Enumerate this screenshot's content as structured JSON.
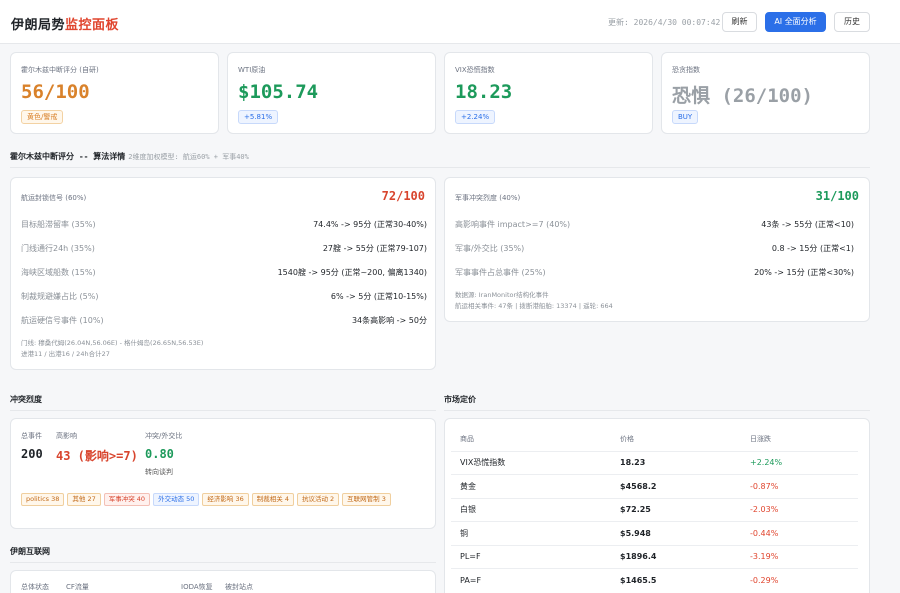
{
  "header": {
    "title_main": "伊朗局势",
    "title_accent": "监控面板",
    "updated": "更新: 2026/4/30 00:07:42",
    "btn_refresh": "刷新",
    "btn_ai": "AI 全面分析",
    "btn_history": "历史"
  },
  "kpis": [
    {
      "label": "霍尔木兹中断评分 (自研)",
      "value": "56/100",
      "badge": "黄色/警戒",
      "color": "#d9822b"
    },
    {
      "label": "WTI原油",
      "value": "$105.74",
      "badge": "+5.81%",
      "color": "#1d9a5b"
    },
    {
      "label": "VIX恐慌指数",
      "value": "18.23",
      "badge": "+2.24%",
      "color": "#1d9a5b"
    },
    {
      "label": "恐贪指数",
      "value": "恐惧 (26/100)",
      "badge": "BUY",
      "color": "#9aa0a6"
    }
  ],
  "algo": {
    "title": "霍尔木兹中断评分 -- 算法详情",
    "subtitle": "2维度加权模型: 航运60% + 军事40%"
  },
  "shipping": {
    "head": "航运封锁信号 (60%)",
    "score": "72/100",
    "rows": [
      {
        "k": "目标船滞留率 (35%)",
        "v": "74.4% -> 95分 (正常30-40%)"
      },
      {
        "k": "门线通行24h (35%)",
        "v": "27艘 -> 55分 (正常79-107)"
      },
      {
        "k": "海峡区域船数 (15%)",
        "v": "1540艘 -> 95分 (正常~200, 偏离1340)"
      },
      {
        "k": "制裁规避嫌占比 (5%)",
        "v": "6% -> 5分 (正常10-15%)"
      },
      {
        "k": "航运硬信号事件 (10%)",
        "v": "34条高影响 -> 50分"
      }
    ],
    "note1": "门线: 穆桑代姆(26.04N,56.06E) - 格什姆岛(26.65N,56.53E)",
    "note2": "进港11 / 出港16 / 24h合计27"
  },
  "military": {
    "head": "军事冲突烈度 (40%)",
    "score": "31/100",
    "rows": [
      {
        "k": "高影响事件 impact>=7 (40%)",
        "v": "43条 -> 55分 (正常<10)"
      },
      {
        "k": "军事/外交比 (35%)",
        "v": "0.8 -> 15分 (正常<1)"
      },
      {
        "k": "军事事件占总事件 (25%)",
        "v": "20% -> 15分 (正常<30%)"
      }
    ],
    "note1": "数据源: IranMonitor结构化事件",
    "note2": "航运相关事件: 47条 | 拨断港船舶: 13374 | 遥轮: 664"
  },
  "conflict": {
    "title": "冲突烈度",
    "total_label": "总事件",
    "total": "200",
    "high_label": "高影响",
    "high": "43 (影响>=7)",
    "ratio_label": "冲突/外交比",
    "ratio": "0.80",
    "trend": "转向谈判",
    "tags": [
      {
        "text": "politics 38",
        "style": "orange"
      },
      {
        "text": "其他 27",
        "style": "orange"
      },
      {
        "text": "军事冲突 40",
        "style": "red"
      },
      {
        "text": "外交动态 50",
        "style": "blue"
      },
      {
        "text": "经济影响 36",
        "style": "orange"
      },
      {
        "text": "制裁相关 4",
        "style": "orange"
      },
      {
        "text": "抗议活动 2",
        "style": "orange"
      },
      {
        "text": "互联网管制 3",
        "style": "orange"
      }
    ]
  },
  "internet": {
    "title": "伊朗互联网",
    "cols": [
      "总体状态",
      "CF流量",
      "IODA恢复",
      "被封站点"
    ]
  },
  "market": {
    "title": "市场定价",
    "headers": [
      "商品",
      "价格",
      "日涨跌"
    ],
    "rows": [
      {
        "name": "VIX恐慌指数",
        "price": "18.23",
        "change": "+2.24%",
        "dir": "up"
      },
      {
        "name": "黄金",
        "price": "$4568.2",
        "change": "-0.87%",
        "dir": "down"
      },
      {
        "name": "白银",
        "price": "$72.25",
        "change": "-2.03%",
        "dir": "down"
      },
      {
        "name": "铜",
        "price": "$5.948",
        "change": "-0.44%",
        "dir": "down"
      },
      {
        "name": "PL=F",
        "price": "$1896.4",
        "change": "-3.19%",
        "dir": "down"
      },
      {
        "name": "PA=F",
        "price": "$1465.5",
        "change": "-0.29%",
        "dir": "down"
      }
    ]
  }
}
